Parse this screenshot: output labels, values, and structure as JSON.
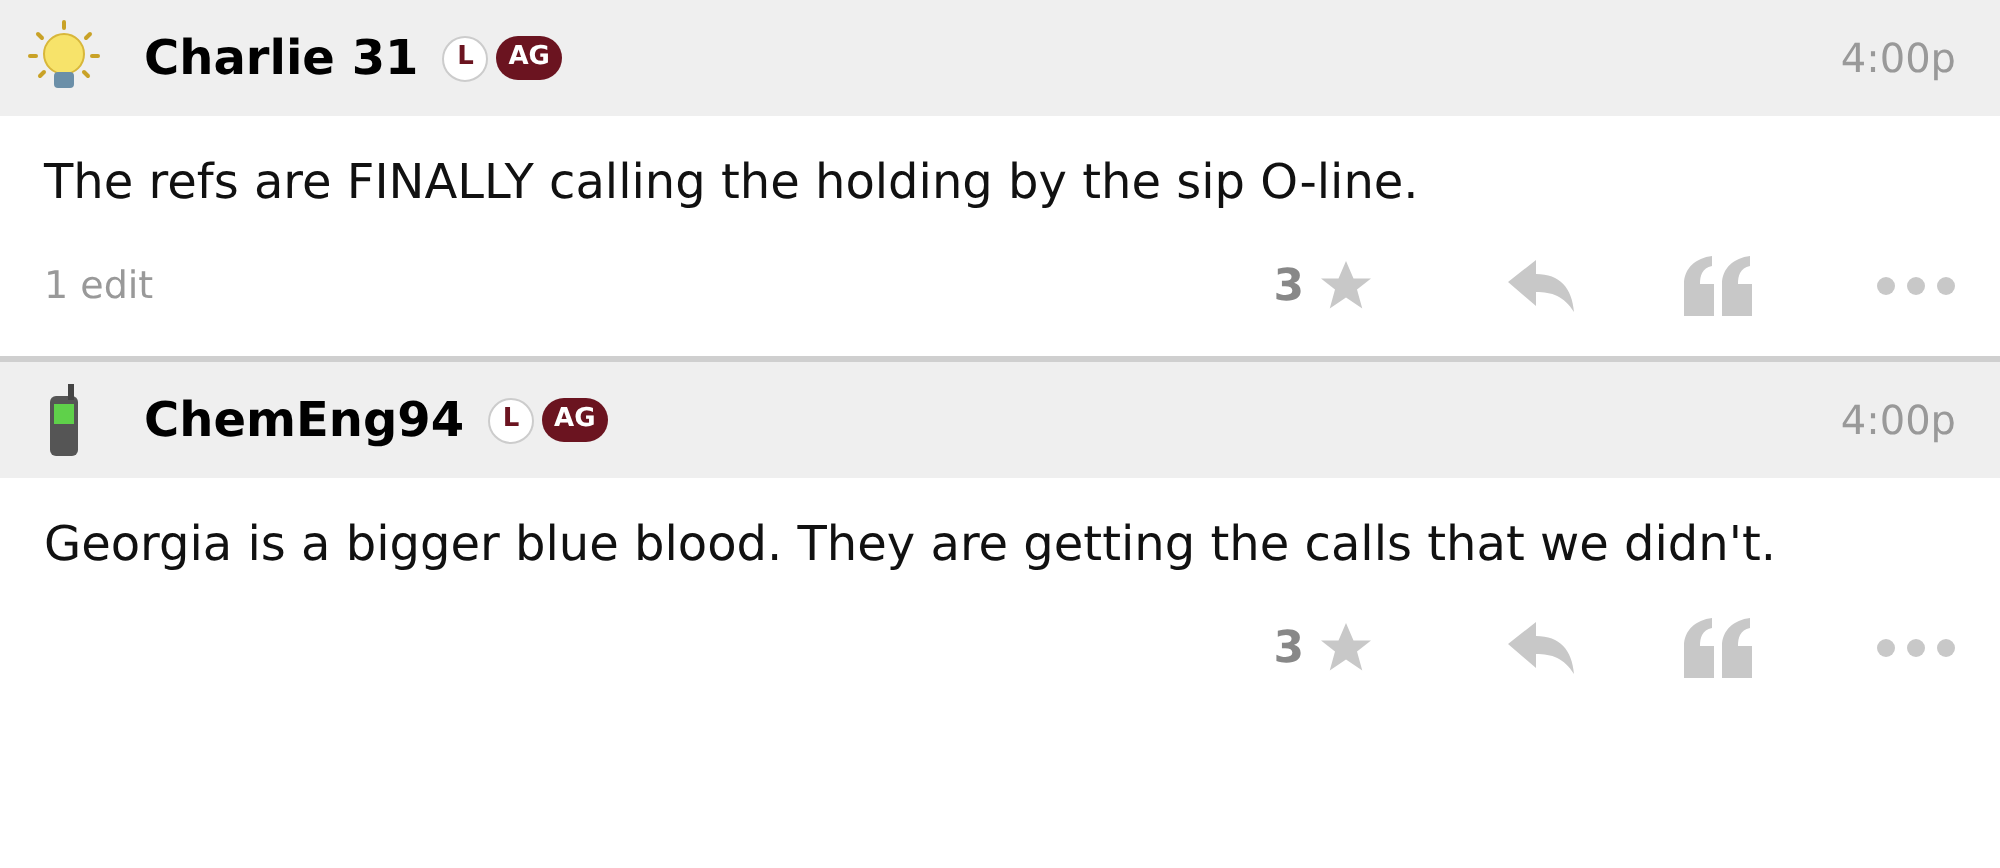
{
  "posts": [
    {
      "avatar": {
        "kind": "lightbulb"
      },
      "username": "Charlie 31",
      "badges": [
        "L",
        "AG"
      ],
      "time": "4:00p",
      "body": "The refs are FINALLY calling the holding by the sip O-line.",
      "edit_note": "1 edit",
      "stars_count": "3"
    },
    {
      "avatar": {
        "kind": "phone"
      },
      "username": "ChemEng94",
      "badges": [
        "L",
        "AG"
      ],
      "time": "4:00p",
      "body": "Georgia is a bigger blue blood. They are getting the calls that we didn't.",
      "stars_count": "3"
    }
  ]
}
